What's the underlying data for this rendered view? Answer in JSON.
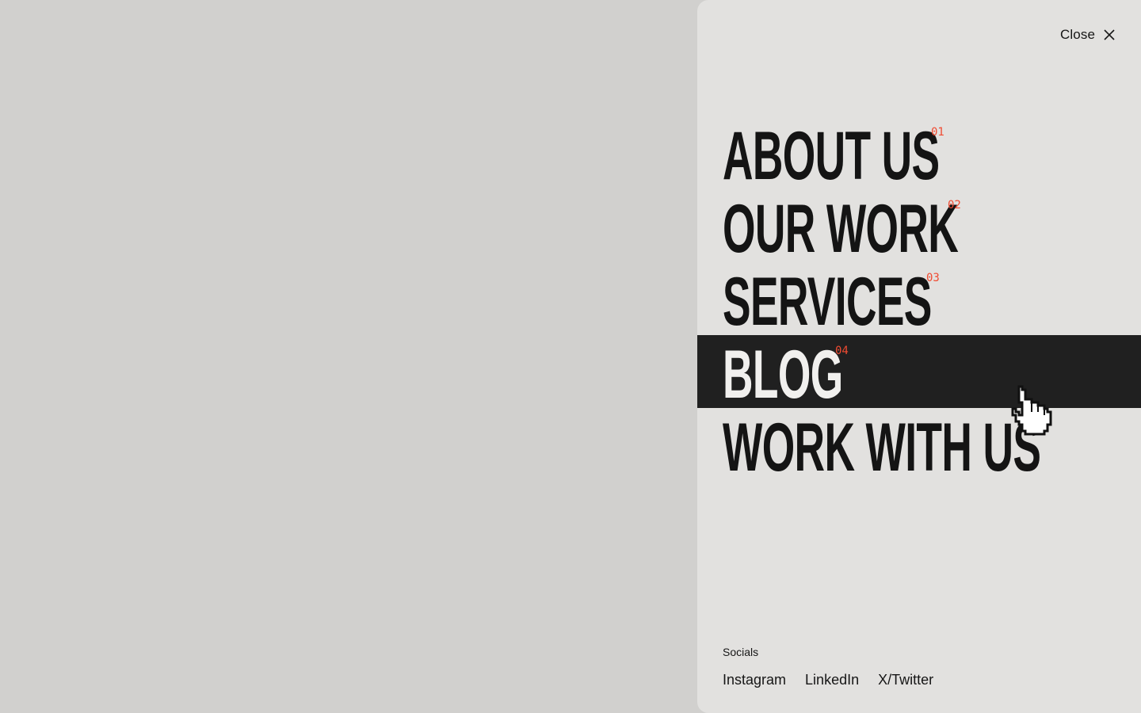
{
  "header": {
    "close_label": "Close",
    "close_icon": "close-icon"
  },
  "nav": {
    "items": [
      {
        "label": "ABOUT US",
        "num": "01",
        "active": false
      },
      {
        "label": "OUR WORK",
        "num": "02",
        "active": false
      },
      {
        "label": "SERVICES",
        "num": "03",
        "active": false
      },
      {
        "label": "BLOG",
        "num": "04",
        "active": true
      },
      {
        "label": "WORK WITH US",
        "num": "",
        "active": false
      }
    ]
  },
  "socials": {
    "title": "Socials",
    "links": [
      "Instagram",
      "LinkedIn",
      "X/Twitter"
    ]
  },
  "colors": {
    "accent": "#f04b32",
    "panel_bg": "#e2e1df",
    "backdrop_bg": "#d1d0ce",
    "active_bg": "#202020"
  },
  "cursor_icon": "pointer-hand-icon"
}
